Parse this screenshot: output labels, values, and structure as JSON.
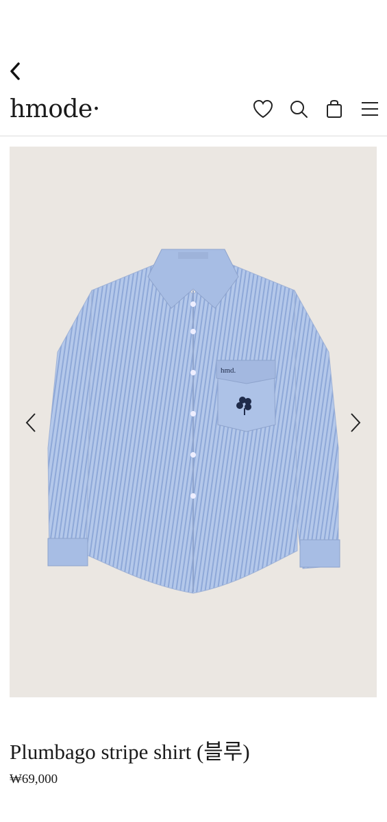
{
  "nav": {
    "back_icon": "chevron-left-icon"
  },
  "header": {
    "logo": "hmode·",
    "icons": [
      "heart-icon",
      "search-icon",
      "shopping-bag-icon",
      "menu-icon"
    ]
  },
  "product": {
    "image": {
      "description_icon": "striped-shirt",
      "bg_color": "#ebe7e2",
      "shirt_color": "#a9bfe3"
    },
    "pocket_embroidery": "hmd.",
    "title": "Plumbago stripe shirt (블루)",
    "price": "₩69,000"
  }
}
